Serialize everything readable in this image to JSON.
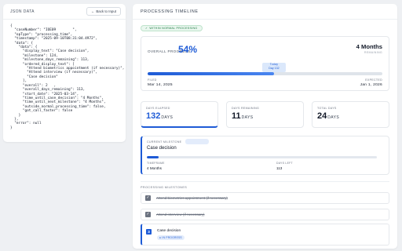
{
  "json_panel": {
    "title": "JSON Data",
    "back_button": "Back to Input",
    "content": "{\n  \"caseNumber\": \"IOE09        \",\n  \"opType\": \"processing_time\",\n  \"timestamp\": \"2025-09-10T08:31:04.4972\",\n  \"data\": {\n    \"data\": {\n      \"display_text\": \"Case decision\",\n      \"milestone\": 124,\n      \"milestone_days_remaining\": 113,\n      \"ordered_display_text\": [\n        \"Attend biometrics appointment (if necessary)\",\n        \"Attend interview (if necessary)\",\n        \"Case decision\"\n      ],\n      \"overall\": 2   ,\n      \"overall_days_remaining\": 113,\n      \"start_date\": \"2025-03-14\",\n      \"time_until_case_decision\": \"4 Months\",\n      \"time_until_next_milestone\": \"4 Months\",\n      \"outside_normal_processing_time\": false,\n      \"got_call_faster\": false\n    }\n  },\n  \"error\": null\n}"
  },
  "main": {
    "title": "Processing Timeline",
    "status_pill": "Within normal processing",
    "overall_label": "Overall Progress",
    "overall_pct": "54%",
    "overall_progress": 0.54,
    "duration_value": "4 Months",
    "duration_label": "Remaining",
    "today_label": "Today",
    "today_day": "Day 132",
    "filed_label": "Filed",
    "filed_date": "Mar 14, 2025",
    "expected_label": "Expected",
    "expected_date": "Jan 1, 2026",
    "stats": [
      {
        "label": "Days Elapsed",
        "value": "132",
        "unit": "DAYS",
        "color": "#1e5bd6"
      },
      {
        "label": "Days Remaining",
        "value": "11",
        "unit": "DAYS",
        "color": "#111827"
      },
      {
        "label": "Total Days",
        "value": "24",
        "unit": "DAYS",
        "color": "#111827"
      }
    ],
    "current_milestone": {
      "label": "Current Milestone",
      "name": "Case decision",
      "progress": 0.05,
      "timeframe_label": "Timeframe",
      "timeframe_value": "4 Months",
      "days_left_label": "Days Left",
      "days_left_value": "113"
    },
    "milestones_title": "Processing Milestones",
    "milestones": [
      "Attend biometrics appointment (if necessary)",
      "Attend interview (if necessary)"
    ],
    "current_item": {
      "number": "3",
      "text": "Case decision",
      "badge": "In progress"
    }
  },
  "colors": {
    "accent": "#1e5bd6",
    "success": "#1f7a43",
    "muted": "#6b7280"
  }
}
